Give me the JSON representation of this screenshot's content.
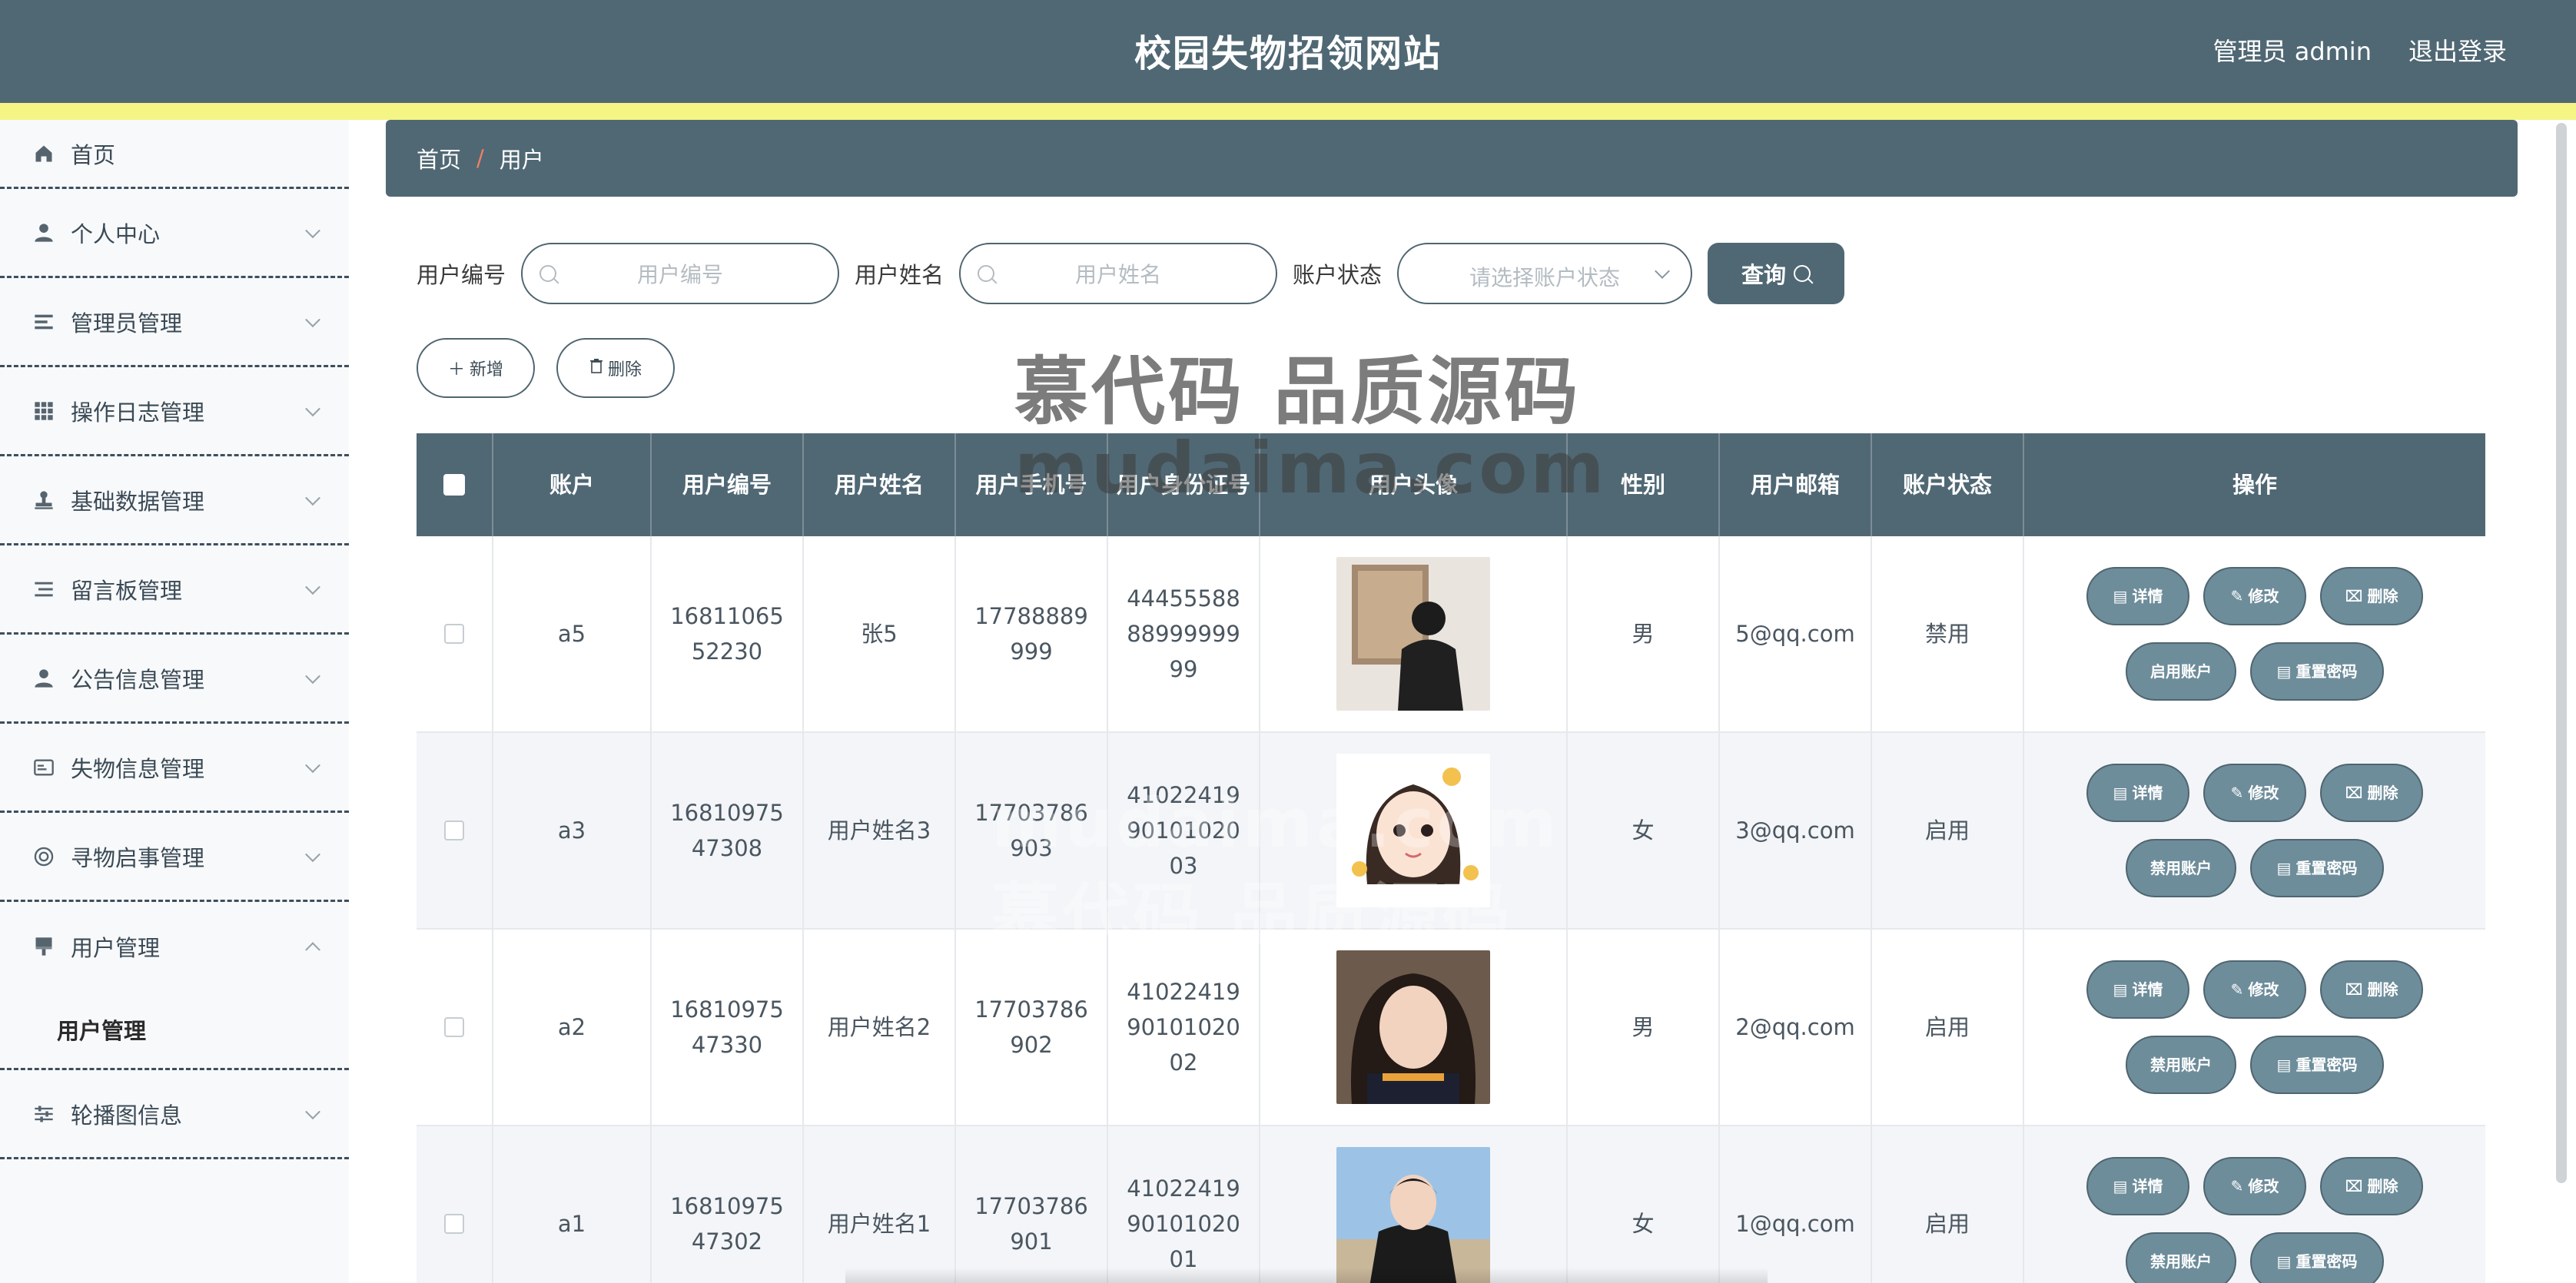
{
  "header": {
    "title": "校园失物招领网站",
    "admin_label": "管理员 admin",
    "logout_label": "退出登录"
  },
  "sidebar": {
    "items": [
      {
        "label": "首页",
        "icon": "home-icon"
      },
      {
        "label": "个人中心",
        "icon": "user-icon"
      },
      {
        "label": "管理员管理",
        "icon": "list-icon"
      },
      {
        "label": "操作日志管理",
        "icon": "grid-icon"
      },
      {
        "label": "基础数据管理",
        "icon": "stamp-icon"
      },
      {
        "label": "留言板管理",
        "icon": "list-icon"
      },
      {
        "label": "公告信息管理",
        "icon": "user-icon"
      },
      {
        "label": "失物信息管理",
        "icon": "card-icon"
      },
      {
        "label": "寻物启事管理",
        "icon": "lifebuoy-icon"
      },
      {
        "label": "用户管理",
        "icon": "brush-icon"
      },
      {
        "label": "轮播图信息",
        "icon": "sliders-icon"
      }
    ],
    "sub_user": "用户管理"
  },
  "breadcrumb": {
    "home": "首页",
    "sep": "/",
    "current": "用户"
  },
  "search": {
    "code_label": "用户编号",
    "code_placeholder": "用户编号",
    "name_label": "用户姓名",
    "name_placeholder": "用户姓名",
    "status_label": "账户状态",
    "status_placeholder": "请选择账户状态",
    "query_label": "查询"
  },
  "actions": {
    "add_label": "新增",
    "delete_label": "删除"
  },
  "watermark": {
    "line1": "慕代码 品质源码",
    "line2": "mudaima.com"
  },
  "table": {
    "headers": [
      "账户",
      "用户编号",
      "用户姓名",
      "用户手机号",
      "用户身份证号",
      "用户头像",
      "性别",
      "用户邮箱",
      "账户状态",
      "操作"
    ],
    "rows": [
      {
        "account": "a5",
        "code": "1681106552230",
        "name": "张5",
        "phone": "17788889999",
        "idcard": "444555888899999999",
        "gender": "男",
        "email": "5@qq.com",
        "status": "禁用",
        "toggle": "启用账户"
      },
      {
        "account": "a3",
        "code": "1681097547308",
        "name": "用户姓名3",
        "phone": "17703786903",
        "idcard": "410224199010102003",
        "gender": "女",
        "email": "3@qq.com",
        "status": "启用",
        "toggle": "禁用账户"
      },
      {
        "account": "a2",
        "code": "1681097547330",
        "name": "用户姓名2",
        "phone": "17703786902",
        "idcard": "410224199010102002",
        "gender": "男",
        "email": "2@qq.com",
        "status": "启用",
        "toggle": "禁用账户"
      },
      {
        "account": "a1",
        "code": "1681097547302",
        "name": "用户姓名1",
        "phone": "17703786901",
        "idcard": "410224199010102001",
        "gender": "女",
        "email": "1@qq.com",
        "status": "启用",
        "toggle": "禁用账户"
      }
    ],
    "op_detail": "详情",
    "op_edit": "修改",
    "op_delete": "删除",
    "op_reset": "重置密码"
  }
}
